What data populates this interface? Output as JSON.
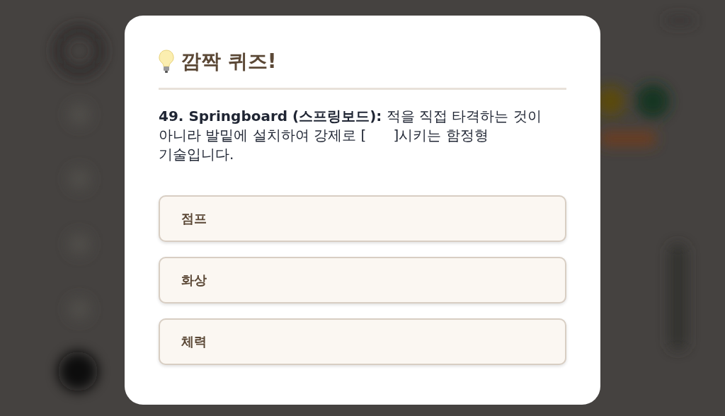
{
  "quiz_dialog": {
    "title": "깜짝 퀴즈!",
    "question": "**49. Springboard (스프링보드):** 적을 직접 타격하는 것이 아니라 발밑에 설치하여 강제로 [      ]시키는 함정형 기술입니다.",
    "options": [
      {
        "label": "점프"
      },
      {
        "label": "화상"
      },
      {
        "label": "체력"
      }
    ]
  }
}
